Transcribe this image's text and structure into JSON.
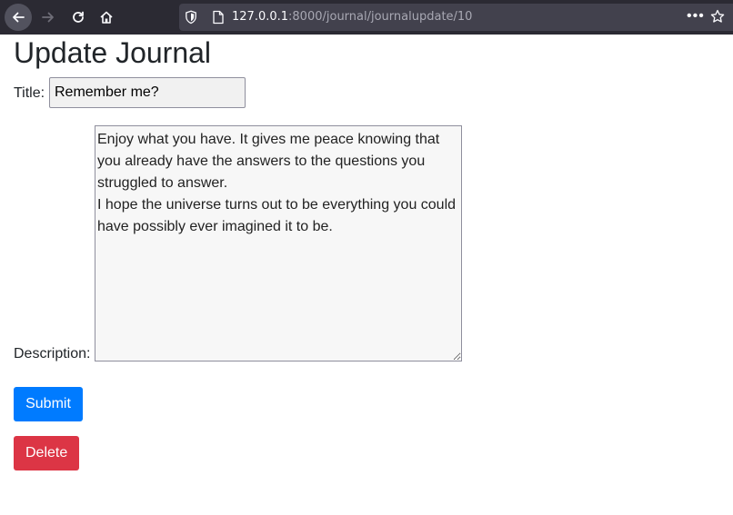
{
  "browser": {
    "url_host": "127.0.0.1",
    "url_rest": ":8000/journal/journalupdate/10",
    "more_menu": "•••"
  },
  "page": {
    "heading": "Update Journal",
    "title_label": "Title:",
    "title_value": "Remember me?",
    "description_label": "Description:",
    "description_value": "Enjoy what you have. It gives me peace knowing that you already have the answers to the questions you struggled to answer.\nI hope the universe turns out to be everything you could have possibly ever imagined it to be.",
    "submit_label": "Submit",
    "delete_label": "Delete"
  },
  "colors": {
    "submit_bg": "#007bff",
    "delete_bg": "#dc3545",
    "toolbar_bg": "#2b2a33"
  }
}
